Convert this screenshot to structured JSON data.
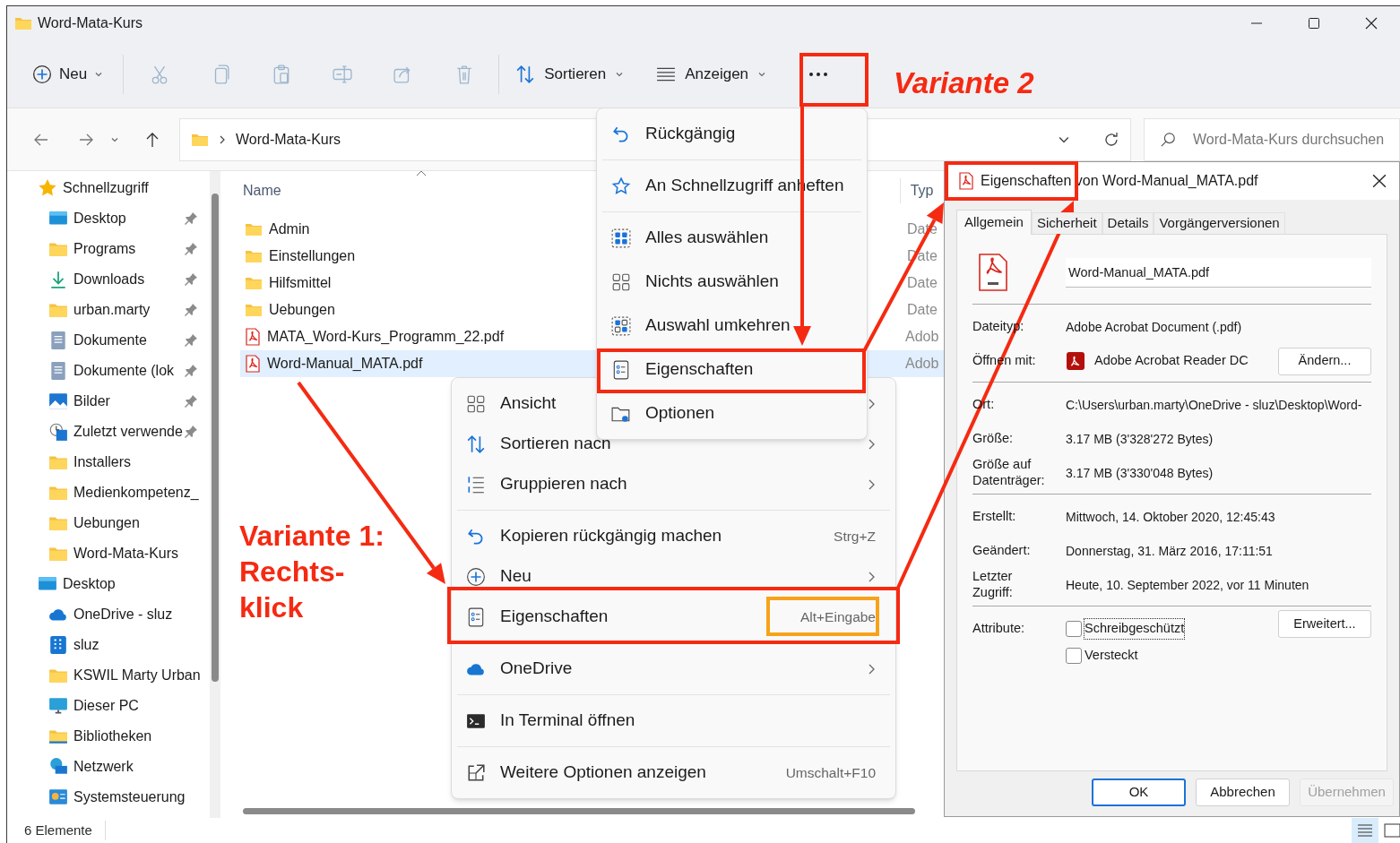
{
  "window": {
    "title": "Word-Mata-Kurs"
  },
  "toolbar": {
    "new_button": "Neu",
    "actions": [
      {
        "kind": "cut",
        "disabled": true
      },
      {
        "kind": "copy",
        "disabled": true
      },
      {
        "kind": "paste",
        "disabled": true
      },
      {
        "kind": "rename",
        "disabled": true
      },
      {
        "kind": "share",
        "disabled": true
      },
      {
        "kind": "delete",
        "disabled": true
      }
    ],
    "sort_button": "Sortieren",
    "view_button": "Anzeigen"
  },
  "address": {
    "path": "Word-Mata-Kurs"
  },
  "search": {
    "placeholder": "Word-Mata-Kurs durchsuchen"
  },
  "sidebar": {
    "items": [
      {
        "label": "Schnellzugriff",
        "kind": "star",
        "pinned": false,
        "children": [
          {
            "label": "Desktop",
            "kind": "desktop",
            "pinned": true
          },
          {
            "label": "Programs",
            "kind": "folder",
            "pinned": true
          },
          {
            "label": "Downloads",
            "kind": "download",
            "pinned": true
          },
          {
            "label": "urban.marty",
            "kind": "folder",
            "pinned": true
          },
          {
            "label": "Dokumente",
            "kind": "document",
            "pinned": true
          },
          {
            "label": "Dokumente (lok",
            "kind": "document",
            "pinned": true
          },
          {
            "label": "Bilder",
            "kind": "pictures",
            "pinned": true
          },
          {
            "label": "Zuletzt verwende",
            "kind": "recent",
            "pinned": true
          },
          {
            "label": "Installers",
            "kind": "folder",
            "pinned": false
          },
          {
            "label": "Medienkompetenz_",
            "kind": "folder",
            "pinned": false
          },
          {
            "label": "Uebungen",
            "kind": "folder",
            "pinned": false
          },
          {
            "label": "Word-Mata-Kurs",
            "kind": "folder",
            "pinned": false
          }
        ]
      },
      {
        "label": "Desktop",
        "kind": "desktop",
        "pinned": false,
        "children": [
          {
            "label": "OneDrive - sluz",
            "kind": "cloud",
            "pinned": false
          },
          {
            "label": "sluz",
            "kind": "building",
            "pinned": false
          },
          {
            "label": "KSWIL Marty Urban",
            "kind": "folder",
            "pinned": false
          },
          {
            "label": "Dieser PC",
            "kind": "pc",
            "pinned": false
          },
          {
            "label": "Bibliotheken",
            "kind": "library",
            "pinned": false
          },
          {
            "label": "Netzwerk",
            "kind": "network",
            "pinned": false
          },
          {
            "label": "Systemsteuerung",
            "kind": "control",
            "pinned": false
          }
        ]
      }
    ]
  },
  "file_list": {
    "columns": [
      "Name",
      "Typ"
    ],
    "rows": [
      {
        "name": "Admin",
        "kind": "folder",
        "type": "Date",
        "selected": false
      },
      {
        "name": "Einstellungen",
        "kind": "folder",
        "type": "Date",
        "selected": false
      },
      {
        "name": "Hilfsmittel",
        "kind": "folder",
        "type": "Date",
        "selected": false
      },
      {
        "name": "Uebungen",
        "kind": "folder",
        "type": "Date",
        "selected": false
      },
      {
        "name": "MATA_Word-Kurs_Programm_22.pdf",
        "kind": "pdf",
        "type": "Adob",
        "selected": false
      },
      {
        "name": "Word-Manual_MATA.pdf",
        "kind": "pdf",
        "type": "Adob",
        "selected": true
      }
    ]
  },
  "more_menu": {
    "groups": [
      [
        {
          "label": "Rückgängig",
          "kind": "undo"
        }
      ],
      [
        {
          "label": "An Schnellzugriff anheften",
          "kind": "pin"
        }
      ],
      [
        {
          "label": "Alles auswählen",
          "kind": "select-all"
        },
        {
          "label": "Nichts auswählen",
          "kind": "select-none"
        },
        {
          "label": "Auswahl umkehren",
          "kind": "invert"
        },
        {
          "label": "Eigenschaften",
          "kind": "properties"
        },
        {
          "label": "Optionen",
          "kind": "options"
        }
      ]
    ]
  },
  "context_menu": {
    "groups": [
      [
        {
          "label": "Ansicht",
          "kind": "view",
          "submenu": true
        },
        {
          "label": "Sortieren nach",
          "kind": "sort",
          "submenu": true
        },
        {
          "label": "Gruppieren nach",
          "kind": "group",
          "submenu": true
        }
      ],
      [
        {
          "label": "Kopieren rückgängig machen",
          "kind": "undo",
          "shortcut": "Strg+Z",
          "submenu": false
        },
        {
          "label": "Neu",
          "kind": "new",
          "submenu": true
        },
        {
          "label": "Eigenschaften",
          "kind": "properties",
          "shortcut": "Alt+Eingabe",
          "submenu": false
        }
      ],
      [
        {
          "label": "OneDrive",
          "kind": "cloud",
          "submenu": true
        }
      ],
      [
        {
          "label": "In Terminal öffnen",
          "kind": "terminal",
          "submenu": false
        }
      ],
      [
        {
          "label": "Weitere Optionen anzeigen",
          "kind": "more",
          "shortcut": "Umschalt+F10",
          "submenu": false
        }
      ]
    ]
  },
  "dialog": {
    "title": "Eigenschaften von Word-Manual_MATA.pdf",
    "tabs": [
      {
        "label": "Allgemein",
        "selected": true
      },
      {
        "label": "Sicherheit",
        "selected": false
      },
      {
        "label": "Details",
        "selected": false
      },
      {
        "label": "Vorgängerversionen",
        "selected": false
      }
    ],
    "file_name": "Word-Manual_MATA.pdf",
    "groups": [
      [
        {
          "label": "Dateityp:",
          "value": "Adobe Acrobat Document (.pdf)",
          "kind": "text"
        },
        {
          "label": "Öffnen mit:",
          "value": "Adobe Acrobat Reader DC",
          "kind": "app",
          "button": "Ändern..."
        }
      ],
      [
        {
          "label": "Ort:",
          "value": "C:\\Users\\urban.marty\\OneDrive - sluz\\Desktop\\Word-",
          "kind": "text"
        },
        {
          "label": "Größe:",
          "value": "3.17 MB (3'328'272 Bytes)",
          "kind": "text"
        },
        {
          "label": "Größe auf Datenträger:",
          "value": "3.17 MB (3'330'048 Bytes)",
          "kind": "text"
        }
      ],
      [
        {
          "label": "Erstellt:",
          "value": "Mittwoch, 14. Oktober 2020, 12:45:43",
          "kind": "text"
        },
        {
          "label": "Geändert:",
          "value": "Donnerstag, 31. März 2016, 17:11:51",
          "kind": "text"
        },
        {
          "label": "Letzter Zugriff:",
          "value": "Heute, 10. September 2022, vor 11 Minuten",
          "kind": "text"
        }
      ]
    ],
    "attributes": {
      "label": "Attribute:",
      "checkboxes": [
        {
          "label": "Schreibgeschützt",
          "checked": false,
          "focused": true
        },
        {
          "label": "Versteckt",
          "checked": false,
          "focused": false
        }
      ],
      "button": "Erweitert..."
    },
    "buttons": [
      {
        "label": "OK",
        "primary": true,
        "disabled": false
      },
      {
        "label": "Abbrechen",
        "primary": false,
        "disabled": false
      },
      {
        "label": "Übernehmen",
        "primary": false,
        "disabled": true
      }
    ]
  },
  "status_bar": {
    "count": "6 Elemente"
  },
  "annotations": [
    {
      "text": "Variante 2"
    },
    {
      "text": "Variante 1: Rechts-klick"
    }
  ]
}
